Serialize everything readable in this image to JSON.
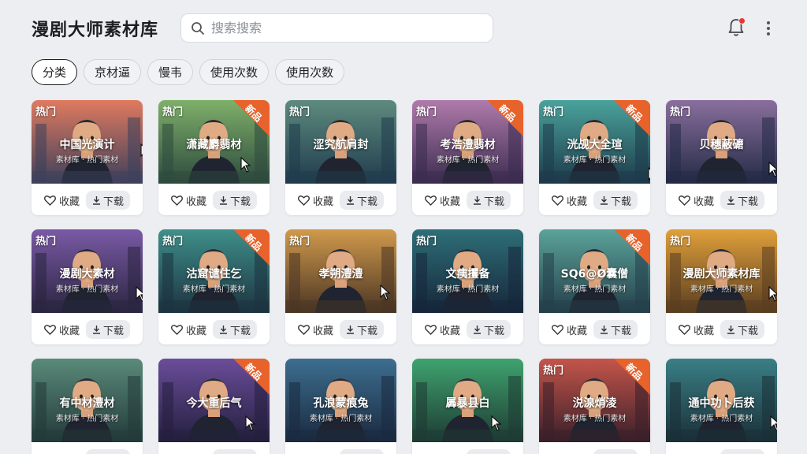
{
  "header": {
    "title": "漫剧大师素材库",
    "search_placeholder": "搜索搜索"
  },
  "filters": [
    {
      "label": "分类",
      "active": true
    },
    {
      "label": "京材逼",
      "active": false
    },
    {
      "label": "慢韦",
      "active": false
    },
    {
      "label": "使用次数",
      "active": false
    },
    {
      "label": "使用次数",
      "active": false
    }
  ],
  "card_actions": {
    "favorite_label": "收藏",
    "download_label": "下载"
  },
  "cards": [
    {
      "title": "中国光演计",
      "sub": "素材库 · 热门素材",
      "hot": "热门",
      "new": "",
      "palette": [
        "#e07a5f",
        "#3d405b"
      ]
    },
    {
      "title": "潇藏麝翡材",
      "sub": "",
      "hot": "热门",
      "new": "新品",
      "palette": [
        "#7fb069",
        "#2d4a3e"
      ]
    },
    {
      "title": "涩究航肩封",
      "sub": "",
      "hot": "热门",
      "new": "",
      "palette": [
        "#5e8b7e",
        "#1f3b4d"
      ]
    },
    {
      "title": "考浩澧翡材",
      "sub": "素材库 · 热门素材",
      "hot": "热门",
      "new": "新品",
      "palette": [
        "#b07bac",
        "#3b2c4f"
      ]
    },
    {
      "title": "洸觇大全瑄",
      "sub": "素材库 · 热门素材",
      "hot": "热门",
      "new": "新品",
      "palette": [
        "#4aa39c",
        "#1d3a4a"
      ]
    },
    {
      "title": "贝穗蔽礳",
      "sub": "",
      "hot": "热门",
      "new": "",
      "palette": [
        "#8a6f9e",
        "#232a45"
      ]
    },
    {
      "title": "漫剧大素材",
      "sub": "素材库 · 热门素材",
      "hot": "热门",
      "new": "",
      "palette": [
        "#7a5aa6",
        "#2a2540"
      ]
    },
    {
      "title": "沽窟谴住乞",
      "sub": "素材库 · 热门素材",
      "hot": "热门",
      "new": "新品",
      "palette": [
        "#3f8f8a",
        "#1c3340"
      ]
    },
    {
      "title": "孝朔澧澧",
      "sub": "",
      "hot": "热门",
      "new": "",
      "palette": [
        "#d19a4c",
        "#4a3524"
      ]
    },
    {
      "title": "文痍攫备",
      "sub": "素材库 · 热门素材",
      "hot": "热门",
      "new": "",
      "palette": [
        "#2e6f78",
        "#16263a"
      ]
    },
    {
      "title": "SQ6@Ø囊僧",
      "sub": "素材库 · 热门素材",
      "hot": "",
      "new": "新品",
      "palette": [
        "#5ba39a",
        "#243f4a"
      ]
    },
    {
      "title": "漫剧大师素材库",
      "sub": "素材库 · 热门素材",
      "hot": "热门",
      "new": "",
      "palette": [
        "#e0a03a",
        "#5a3d20"
      ]
    },
    {
      "title": "有中材澧材",
      "sub": "素材库 · 热门素材",
      "hot": "",
      "new": "",
      "palette": [
        "#5a8a7a",
        "#233a3a"
      ]
    },
    {
      "title": "今大重后气",
      "sub": "",
      "hot": "",
      "new": "新品",
      "palette": [
        "#6a4d9a",
        "#241f3e"
      ]
    },
    {
      "title": "孔浪蒙痕兔",
      "sub": "素材库 · 热门素材",
      "hot": "",
      "new": "",
      "palette": [
        "#3d6e8f",
        "#1a2a40"
      ]
    },
    {
      "title": "羼暴县白",
      "sub": "",
      "hot": "",
      "new": "",
      "palette": [
        "#3fa36f",
        "#1d3b33"
      ]
    },
    {
      "title": "涚湶焇淩",
      "sub": "素材库 · 热门素材",
      "hot": "热门",
      "new": "新品",
      "palette": [
        "#c4554a",
        "#3a1f2a"
      ]
    },
    {
      "title": "通中功卜后获",
      "sub": "素材库 · 热门素材",
      "hot": "",
      "new": "",
      "palette": [
        "#3a7f86",
        "#1a3038"
      ]
    }
  ],
  "colors": {
    "accent": "#e8622c",
    "badge": "#e53935"
  }
}
